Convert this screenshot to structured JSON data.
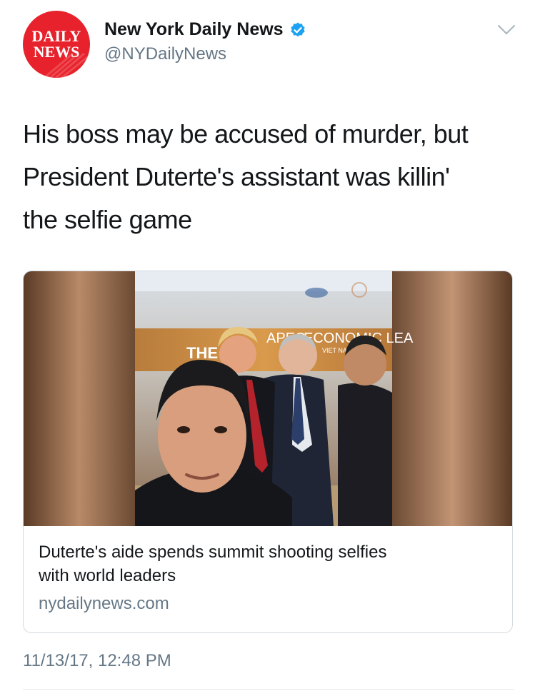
{
  "account": {
    "logo_line1": "DAILY",
    "logo_line2": "NEWS",
    "logo_color": "#e8222c",
    "name": "New York Daily News",
    "handle": "@NYDailyNews",
    "verified_icon": "verified-badge-icon",
    "verified_color": "#1da1f2"
  },
  "tweet": {
    "text_lines": [
      "His boss may be accused of murder, but",
      "President Duterte's assistant was killin'",
      "the selfie game"
    ],
    "menu_icon": "chevron-down-icon",
    "timestamp": "11/13/17, 12:48 PM"
  },
  "card": {
    "image_text": {
      "banner_left": "THE",
      "banner_mid": "APEC",
      "banner_right": "ECONOMIC LEA",
      "banner_sub": "VIET NAM"
    },
    "title_lines": [
      "Duterte's aide spends summit shooting selfies",
      "with world leaders"
    ],
    "domain": "nydailynews.com"
  }
}
